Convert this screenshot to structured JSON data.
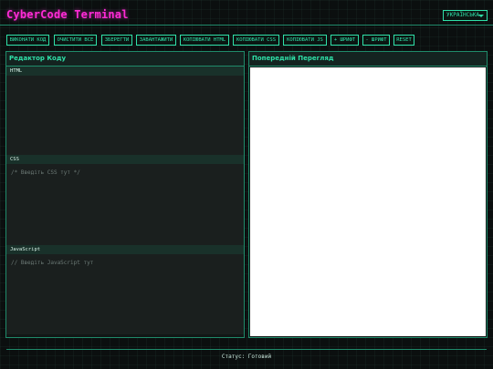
{
  "app": {
    "title": "CyberCode Terminal"
  },
  "language_select": {
    "value": "УКРАЇНСЬКА"
  },
  "toolbar": {
    "buttons": [
      "ВИКОНАТИ КОД",
      "ОЧИСТИТИ ВСЕ",
      "ЗБЕРЕГТИ",
      "ЗАВАНТАЖИТИ",
      "КОПІЮВАТИ HTML",
      "КОПІЮВАТИ CSS",
      "КОПІЮВАТИ JS",
      "+ ШРИФТ",
      "- ШРИФТ",
      "RESET"
    ]
  },
  "editor": {
    "title": "Редактор Коду",
    "html_label": "HTML",
    "html_placeholder": "",
    "css_label": "CSS",
    "css_placeholder": "/* Введіть CSS тут */",
    "js_label": "JavaScript",
    "js_placeholder": "// Введіть JavaScript тут"
  },
  "preview": {
    "title": "Попередній Перегляд"
  },
  "status": {
    "text": "Статус: Готовий"
  },
  "colors": {
    "accent": "#2fe0a8",
    "title": "#ff2bd6",
    "background": "#0b0f0f"
  }
}
